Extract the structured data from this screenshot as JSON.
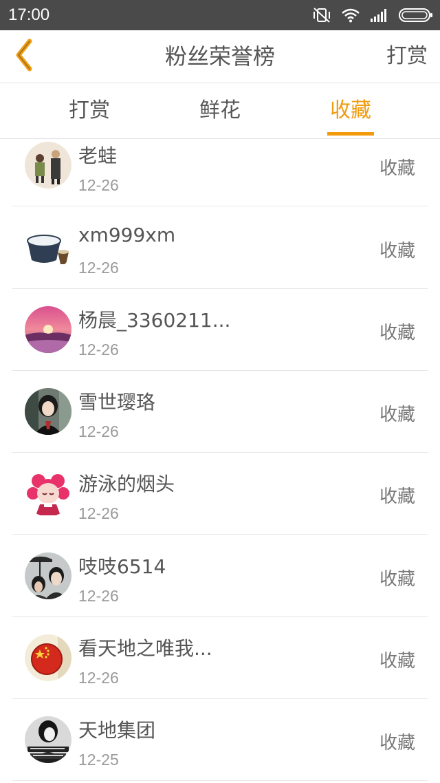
{
  "status_bar": {
    "time": "17:00",
    "icons": [
      "mute-vibrate-icon",
      "wifi-icon",
      "signal-icon",
      "battery-icon"
    ]
  },
  "header": {
    "back_icon": "chevron-left-icon",
    "title": "粉丝荣誉榜",
    "action_label": "打赏"
  },
  "tabs": [
    {
      "label": "打赏",
      "active": false
    },
    {
      "label": "鲜花",
      "active": false
    },
    {
      "label": "收藏",
      "active": true
    }
  ],
  "colors": {
    "accent": "#f29b0d",
    "status_bar_bg": "#4a4a4a",
    "text": "#555555",
    "subtext": "#9a9a9a"
  },
  "list": [
    {
      "name": "老蛙",
      "date": "12-26",
      "action": "收藏",
      "avatar": "couple-illustration-avatar"
    },
    {
      "name": "xm999xm",
      "date": "12-26",
      "action": "收藏",
      "avatar": "rice-bowl-avatar"
    },
    {
      "name": "杨晨_3360211...",
      "date": "12-26",
      "action": "收藏",
      "avatar": "sunset-landscape-avatar"
    },
    {
      "name": "雪世璎珞",
      "date": "12-26",
      "action": "收藏",
      "avatar": "girl-portrait-avatar"
    },
    {
      "name": "游泳的烟头",
      "date": "12-26",
      "action": "收藏",
      "avatar": "pink-anime-girl-avatar"
    },
    {
      "name": "吱吱6514",
      "date": "12-26",
      "action": "收藏",
      "avatar": "couple-umbrella-avatar"
    },
    {
      "name": "看天地之唯我...",
      "date": "12-26",
      "action": "收藏",
      "avatar": "china-flag-badge-avatar"
    },
    {
      "name": "天地集团",
      "date": "12-25",
      "action": "收藏",
      "avatar": "bw-girl-text-avatar"
    }
  ]
}
